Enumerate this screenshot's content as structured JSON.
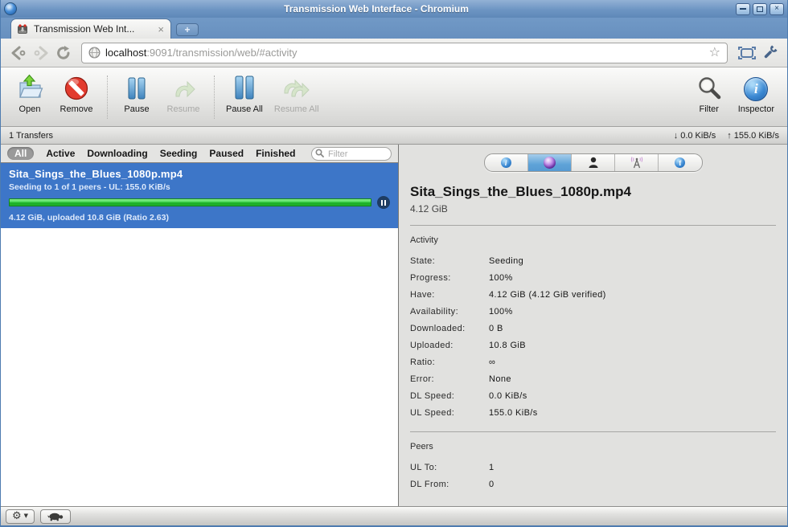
{
  "window": {
    "title": "Transmission Web Interface - Chromium"
  },
  "browser": {
    "tab_title": "Transmission Web Int...",
    "url_host": "localhost",
    "url_path": ":9091/transmission/web/#activity"
  },
  "toolbar": {
    "open": "Open",
    "remove": "Remove",
    "pause": "Pause",
    "resume": "Resume",
    "pause_all": "Pause All",
    "resume_all": "Resume All",
    "filter": "Filter",
    "inspector": "Inspector"
  },
  "statusbar": {
    "transfers": "1 Transfers",
    "down_speed": "0.0 KiB/s",
    "up_speed": "155.0 KiB/s"
  },
  "filterbar": {
    "tabs": [
      "All",
      "Active",
      "Downloading",
      "Seeding",
      "Paused",
      "Finished"
    ],
    "selected": "All",
    "search_placeholder": "Filter"
  },
  "torrent": {
    "name": "Sita_Sings_the_Blues_1080p.mp4",
    "status_line": "Seeding to 1 of 1 peers - UL: 155.0 KiB/s",
    "progress_percent": 100,
    "details_line": "4.12 GiB, uploaded 10.8 GiB (Ratio 2.63)"
  },
  "inspector": {
    "tab_names": [
      "info",
      "activity",
      "peers",
      "tracker",
      "files"
    ],
    "selected_tab": "activity",
    "title": "Sita_Sings_the_Blues_1080p.mp4",
    "size": "4.12 GiB",
    "activity_heading": "Activity",
    "activity_rows": [
      {
        "label": "State:",
        "value": "Seeding"
      },
      {
        "label": "Progress:",
        "value": "100%"
      },
      {
        "label": "Have:",
        "value": "4.12 GiB (4.12 GiB verified)"
      },
      {
        "label": "Availability:",
        "value": "100%"
      },
      {
        "label": "Downloaded:",
        "value": "0 B"
      },
      {
        "label": "Uploaded:",
        "value": "10.8 GiB"
      },
      {
        "label": "Ratio:",
        "value": "∞"
      },
      {
        "label": "Error:",
        "value": "None"
      },
      {
        "label": "DL Speed:",
        "value": "0.0 KiB/s"
      },
      {
        "label": "UL Speed:",
        "value": "155.0 KiB/s"
      }
    ],
    "peers_heading": "Peers",
    "peers_rows": [
      {
        "label": "UL To:",
        "value": "1"
      },
      {
        "label": "DL From:",
        "value": "0"
      }
    ]
  },
  "icons": {
    "window_close": "×",
    "tab_close": "×",
    "new_tab": "+",
    "bookmark_star": "☆",
    "down_arrow": "↓",
    "up_arrow": "↑",
    "gear": "⚙",
    "caret_down": "▼",
    "info_letter": "i",
    "files_letter": "f"
  },
  "colors": {
    "titlebar_blue": "#6d95c3",
    "selection_blue": "#3d76c8",
    "progress_green": "#1fae2b",
    "inspector_tab_blue": "#5fa3d8"
  }
}
